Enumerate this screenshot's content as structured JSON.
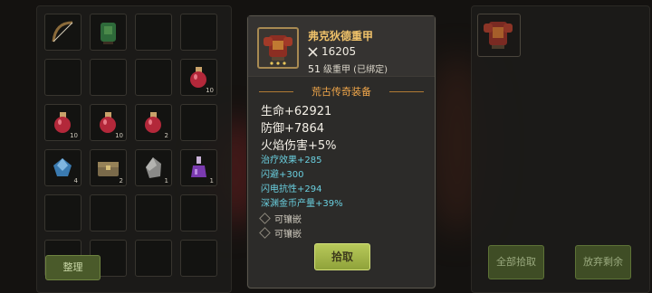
{
  "inventory": {
    "sort_label": "整理",
    "slots": [
      {
        "icon": "bow-icon",
        "count": ""
      },
      {
        "icon": "green-chest-armor-icon",
        "count": ""
      },
      {
        "icon": "",
        "count": ""
      },
      {
        "icon": "",
        "count": ""
      },
      {
        "icon": "",
        "count": ""
      },
      {
        "icon": "",
        "count": ""
      },
      {
        "icon": "",
        "count": ""
      },
      {
        "icon": "health-potion-icon",
        "count": "10"
      },
      {
        "icon": "health-potion-icon",
        "count": "10"
      },
      {
        "icon": "health-potion-icon",
        "count": "10"
      },
      {
        "icon": "health-potion-icon",
        "count": "2"
      },
      {
        "icon": "",
        "count": ""
      },
      {
        "icon": "blue-gem-icon",
        "count": "4"
      },
      {
        "icon": "treasure-chest-icon",
        "count": "2"
      },
      {
        "icon": "stone-icon",
        "count": "1"
      },
      {
        "icon": "purple-potion-icon",
        "count": "1"
      },
      {
        "icon": "",
        "count": ""
      },
      {
        "icon": "",
        "count": ""
      },
      {
        "icon": "",
        "count": ""
      },
      {
        "icon": "",
        "count": ""
      },
      {
        "icon": "",
        "count": ""
      },
      {
        "icon": "",
        "count": ""
      },
      {
        "icon": "",
        "count": ""
      },
      {
        "icon": "",
        "count": ""
      }
    ]
  },
  "tooltip": {
    "item_name": "弗克狄德重甲",
    "power_icon": "crossed-swords-icon",
    "power": "16205",
    "level": "51",
    "level_text": "级重甲 (已绑定)",
    "section_title": "荒古传奇装备",
    "main_stats": [
      {
        "label": "生命",
        "value": "+62921"
      },
      {
        "label": "防御",
        "value": "+7864"
      },
      {
        "label": "火焰伤害",
        "value": "+5%"
      }
    ],
    "sub_stats": [
      {
        "label": "治疗效果",
        "value": "+285"
      },
      {
        "label": "闪避",
        "value": "+300"
      },
      {
        "label": "闪电抗性",
        "value": "+294"
      },
      {
        "label": "深渊金币产量",
        "value": "+39%"
      }
    ],
    "sockets": [
      "可镶嵌",
      "可镶嵌"
    ],
    "pick_label": "拾取"
  },
  "loot": {
    "take_all_label": "全部拾取",
    "discard_rest_label": "放弃剩余",
    "item_icon": "red-heavy-armor-icon"
  },
  "colors": {
    "item_name": "#f0c26a",
    "section_title": "#f0a64a",
    "sub_stat": "#6ad0e0",
    "pick_button": "#a8ba4c"
  }
}
